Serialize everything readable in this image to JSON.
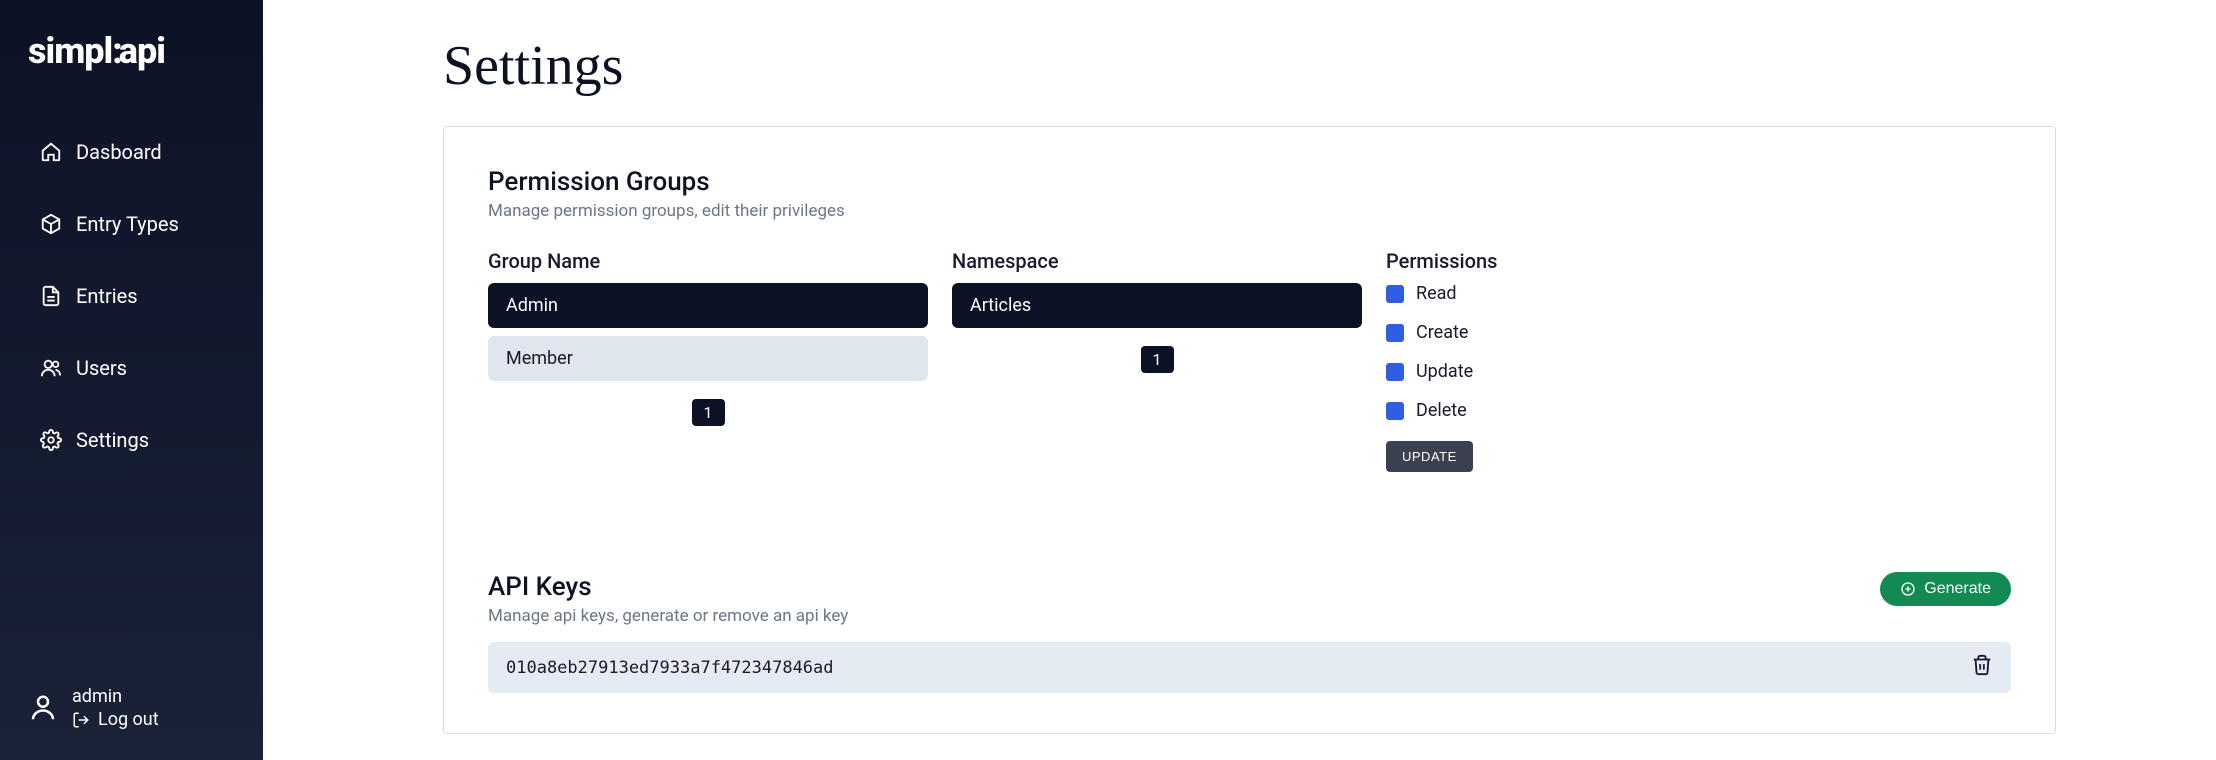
{
  "brand": {
    "part1": "simpl",
    "part2": "api"
  },
  "sidebar": {
    "items": [
      {
        "label": "Dasboard"
      },
      {
        "label": "Entry Types"
      },
      {
        "label": "Entries"
      },
      {
        "label": "Users"
      },
      {
        "label": "Settings"
      }
    ],
    "footer": {
      "username": "admin",
      "logout_label": "Log out"
    }
  },
  "page": {
    "title": "Settings"
  },
  "permission_groups": {
    "title": "Permission Groups",
    "subtitle": "Manage permission groups, edit their privileges",
    "columns": {
      "group": "Group Name",
      "namespace": "Namespace",
      "permissions": "Permissions"
    },
    "groups": [
      {
        "name": "Admin"
      },
      {
        "name": "Member"
      }
    ],
    "groups_page": "1",
    "namespaces": [
      {
        "name": "Articles"
      }
    ],
    "namespaces_page": "1",
    "permissions": [
      {
        "label": "Read",
        "checked": true
      },
      {
        "label": "Create",
        "checked": true
      },
      {
        "label": "Update",
        "checked": true
      },
      {
        "label": "Delete",
        "checked": true
      }
    ],
    "update_label": "UPDATE"
  },
  "api_keys": {
    "title": "API Keys",
    "subtitle": "Manage api keys, generate or remove an api key",
    "generate_label": "Generate",
    "keys": [
      {
        "value": "010a8eb27913ed7933a7f472347846ad"
      }
    ]
  }
}
